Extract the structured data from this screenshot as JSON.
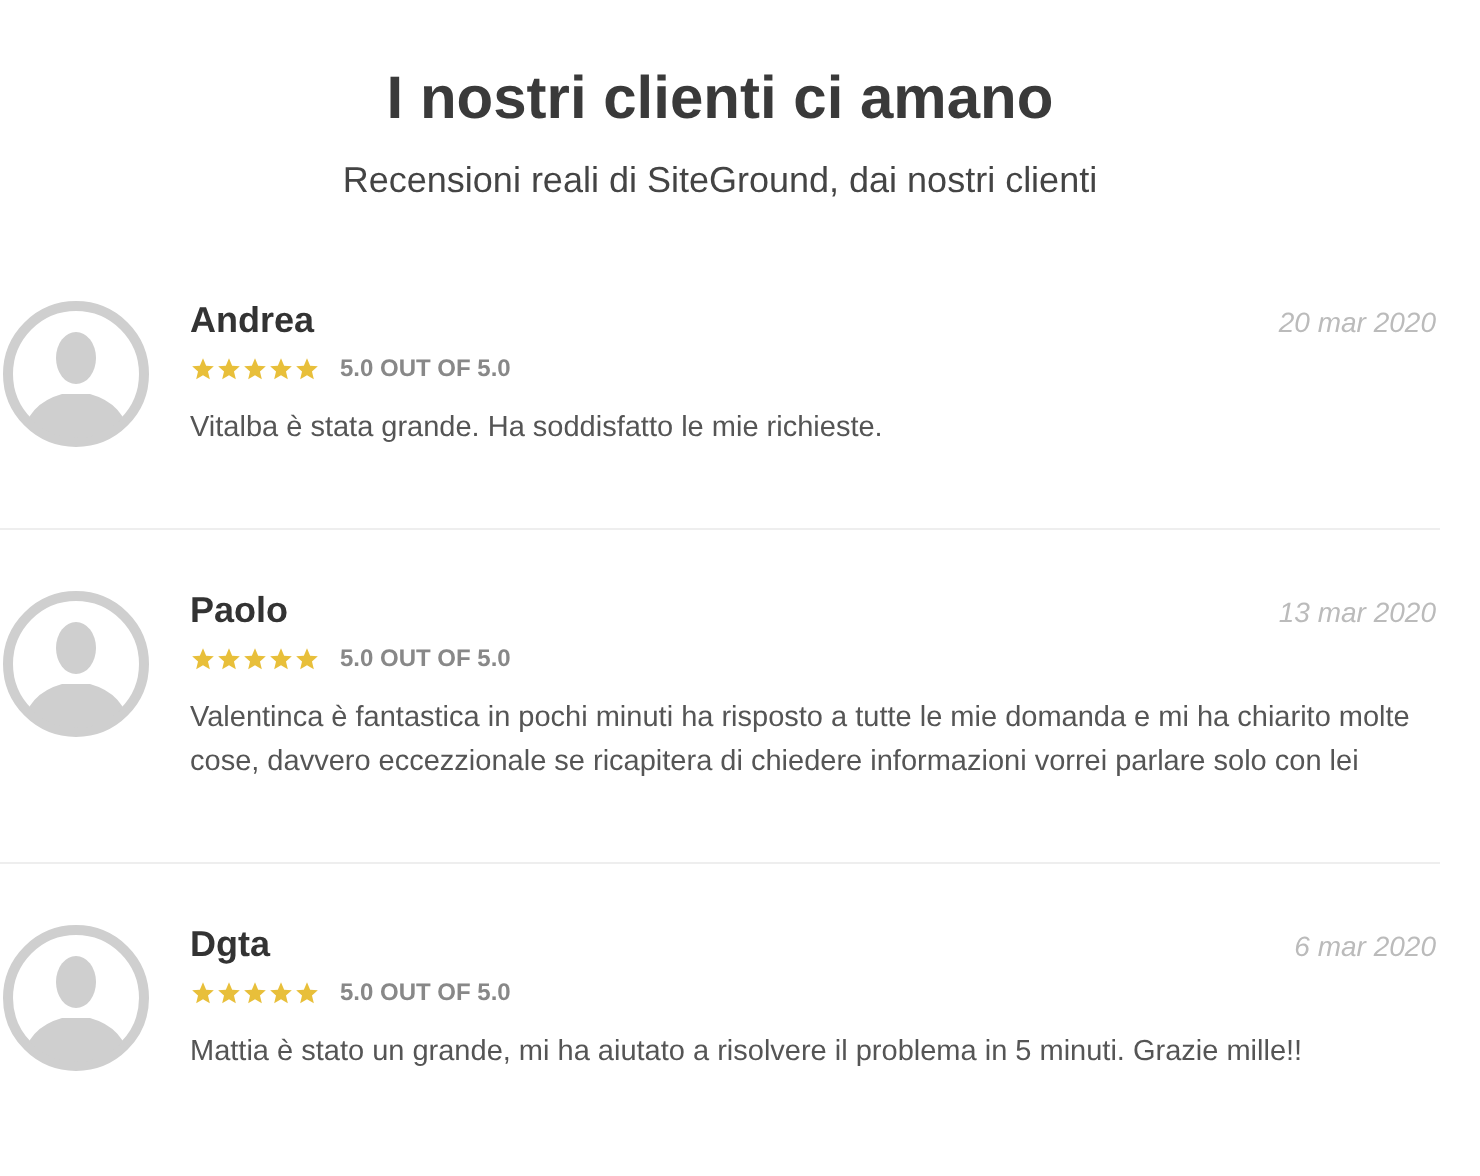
{
  "header": {
    "title": "I nostri clienti ci amano",
    "subtitle": "Recensioni reali di SiteGround, dai nostri clienti"
  },
  "reviews": [
    {
      "name": "Andrea",
      "date": "20 mar 2020",
      "stars": 5,
      "rating": "5.0 OUT OF 5.0",
      "text": "Vitalba è stata grande. Ha soddisfatto le mie richieste."
    },
    {
      "name": "Paolo",
      "date": "13 mar 2020",
      "stars": 5,
      "rating": "5.0 OUT OF 5.0",
      "text": "Valentinca è fantastica in pochi minuti ha risposto a tutte le mie domanda e mi ha chiarito molte cose, davvero eccezzionale se ricapitera di chiedere informazioni vorrei parlare solo con lei"
    },
    {
      "name": "Dgta",
      "date": "6 mar 2020",
      "stars": 5,
      "rating": "5.0 OUT OF 5.0",
      "text": "Mattia è stato un grande, mi ha aiutato a risolvere il problema in 5 minuti. Grazie mille!!"
    }
  ]
}
